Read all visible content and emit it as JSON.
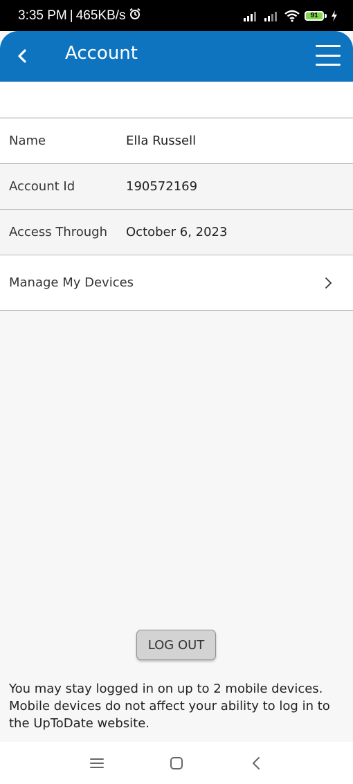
{
  "status_bar": {
    "time": "3:35 PM",
    "speed": "465KB/s",
    "battery": "91"
  },
  "header": {
    "title": "Account"
  },
  "account_rows": [
    {
      "label": "Name",
      "value": "Ella Russell"
    },
    {
      "label": "Account Id",
      "value": "190572169"
    },
    {
      "label": "Access Through",
      "value": "October 6, 2023"
    }
  ],
  "manage_devices": {
    "label": "Manage My Devices"
  },
  "logout": {
    "label": "LOG OUT"
  },
  "note": "You may stay logged in on up to 2 mobile devices. Mobile devices do not affect your ability to log in to the UpToDate website.",
  "colors": {
    "header_bg": "#0f74c0",
    "page_bg": "#f7f7f7"
  },
  "icons": [
    "alarm-icon",
    "signal-icon",
    "wifi-icon",
    "battery-icon",
    "charging-icon",
    "back-icon",
    "menu-icon",
    "chevron-right-icon",
    "nav-menu-icon",
    "nav-home-icon",
    "nav-back-icon"
  ]
}
